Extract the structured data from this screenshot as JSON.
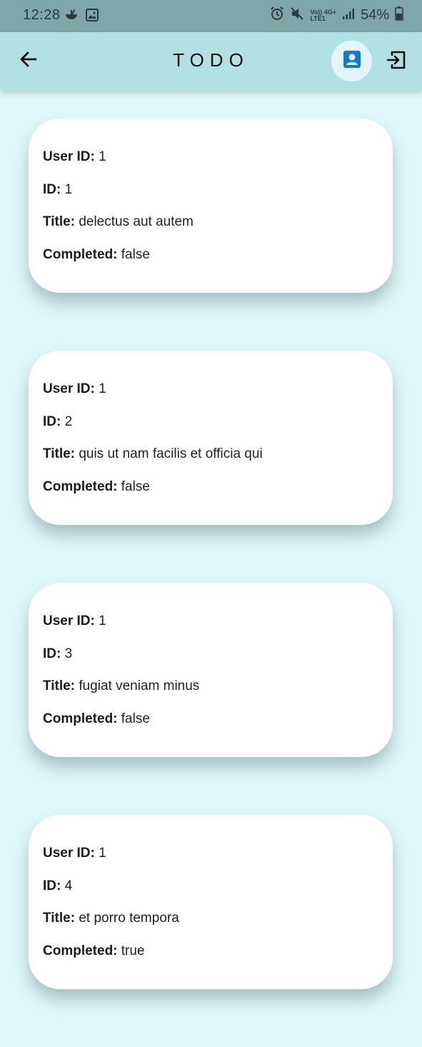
{
  "status_bar": {
    "time": "12:28",
    "battery": "54%",
    "network_top": "Vo)) 4G+",
    "network_bottom": "LTE1"
  },
  "app_bar": {
    "title": "TODO",
    "back_icon": "arrow-left-icon",
    "profile_icon": "account-box-icon",
    "logout_icon": "exit-to-app-icon"
  },
  "labels": {
    "user_id": "User ID:",
    "id": "ID:",
    "title": "Title:",
    "completed": "Completed:"
  },
  "todos": [
    {
      "user_id": "1",
      "id": "1",
      "title": "delectus aut autem",
      "completed": "false"
    },
    {
      "user_id": "1",
      "id": "2",
      "title": "quis ut nam facilis et officia qui",
      "completed": "false"
    },
    {
      "user_id": "1",
      "id": "3",
      "title": "fugiat veniam minus",
      "completed": "false"
    },
    {
      "user_id": "1",
      "id": "4",
      "title": "et porro tempora",
      "completed": "true"
    }
  ],
  "colors": {
    "status_bar": "#7fa6a8",
    "app_bar": "#b2e1e3",
    "background": "#dff8fb",
    "profile_icon": "#1976d2"
  }
}
